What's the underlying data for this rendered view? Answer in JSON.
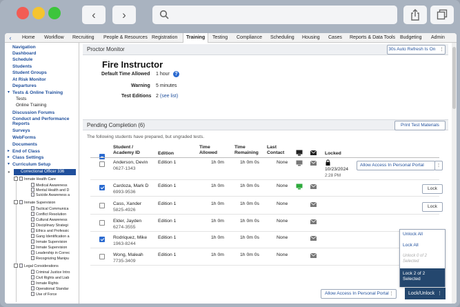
{
  "browser": {
    "colors": {
      "close": "#f25c54",
      "minimize": "#f4c430",
      "maximize": "#3cc53c"
    }
  },
  "nav": {
    "items": [
      "Home",
      "Workflow",
      "Recruiting",
      "People & Resources",
      "Registration",
      "Training",
      "Testing",
      "Compliance",
      "Scheduling",
      "Housing",
      "Cases",
      "Reports & Data Tools",
      "Budgeting",
      "Admin"
    ],
    "active": "Training"
  },
  "sidebar": {
    "links": [
      "Navigation",
      "Dashboard",
      "Schedule",
      "Students",
      "Student Groups",
      "At Risk Monitor",
      "Departures"
    ],
    "tests_section": "Tests & Online Training",
    "tests_sub": [
      "Tests",
      "Online Training"
    ],
    "links2": [
      "Discussion Forums",
      "Conduct and Performance",
      "Reports",
      "Surveys",
      "WebForms",
      "Documents"
    ],
    "end_of_class": "End of Class",
    "class_settings": "Class Settings",
    "curriculum_setup": "Curriculum Setup",
    "highlight": "Correctional Officer 336",
    "tree": {
      "folder1": "Inmate Health Care",
      "folder1_items": [
        "Medical Awareness",
        "Mental Health and D",
        "Suicide Awareness a"
      ],
      "folder2": "Inmate Supervision",
      "folder2_items": [
        "Tactical Communica",
        "Conflict Resolution",
        "Cultural Awareness",
        "Disciplinary Strategi",
        "Ethics and Professic",
        "Gang Identification a",
        "Inmate Supervision",
        "Inmate Supervision",
        "Leadership in Correc",
        "Recognizing Manipu"
      ],
      "folder3": "Legal Considerations",
      "folder3_items": [
        "Criminal Justice Intro",
        "Civil Rights and Liab",
        "Inmate Rights",
        "Operational Standar",
        "Use of Force"
      ]
    }
  },
  "proctor": {
    "header": "Proctor Monitor",
    "auto_refresh": "30s Auto Refresh Is On",
    "title": "Fire Instructor",
    "time_label": "Default Time Allowed",
    "time_value": "1 hour",
    "warning_label": "Warning",
    "warning_value": "5 minutes",
    "editions_label": "Test Editions",
    "editions_count": "2",
    "editions_link": "(see list)"
  },
  "pending": {
    "header": "Pending Completion (6)",
    "print_button": "Print Test Materials",
    "description": "The following students have prepared, but ungraded tests.",
    "columns": {
      "student": [
        "Student /",
        "Academy ID"
      ],
      "edition": "Edition",
      "time_allowed": [
        "Time",
        "Allowed"
      ],
      "time_remaining": [
        "Time",
        "Remaining"
      ],
      "last_contact": [
        "Last",
        "Contact"
      ],
      "locked": "Locked"
    },
    "rows": [
      {
        "name": "Anderson, Devin",
        "id": "0627-1343",
        "edition": "Edition 1",
        "allowed": "1h 0m",
        "remaining": "1h 0m 0s",
        "contact": "None",
        "checked": false,
        "device": "gray",
        "locked_date": "10/23/2024",
        "locked_time": "2:28 PM",
        "action": "Allow Access In Personal Portal"
      },
      {
        "name": "Cardoza, Mark D",
        "id": "6993-9536",
        "edition": "Edition 1",
        "allowed": "1h 0m",
        "remaining": "1h 0m 0s",
        "contact": "None",
        "checked": true,
        "device": "green",
        "action": "Lock"
      },
      {
        "name": "Cass, Xander",
        "id": "5825-4926",
        "edition": "Edition 1",
        "allowed": "1h 0m",
        "remaining": "1h 0m 0s",
        "contact": "None",
        "checked": false,
        "device": "",
        "action": "Lock"
      },
      {
        "name": "Elder, Jayden",
        "id": "6274-3555",
        "edition": "Edition 1",
        "allowed": "1h 0m",
        "remaining": "1h 0m 0s",
        "contact": "None",
        "checked": false,
        "device": "",
        "action": ""
      },
      {
        "name": "Rodriquez, Mike",
        "id": "1963-8244",
        "edition": "Edition 1",
        "allowed": "1h 0m",
        "remaining": "1h 0m 0s",
        "contact": "None",
        "checked": true,
        "device": "",
        "action": ""
      },
      {
        "name": "Wong, Maleah",
        "id": "7735-3409",
        "edition": "Edition 1",
        "allowed": "1h 0m",
        "remaining": "1h 0m 0s",
        "contact": "None",
        "checked": false,
        "device": "",
        "action": ""
      }
    ],
    "menu": {
      "unlock_all": "Unlock All",
      "lock_all": "Lock All",
      "unlock_sel_1": "Unlock 0 of 2",
      "unlock_sel_2": "Selected",
      "lock_sel_1": "Lock 2 of 2",
      "lock_sel_2": "Selected"
    },
    "bottom_allow": "Allow Access In Personal Portal",
    "lock_unlock": "Lock/Unlock"
  }
}
